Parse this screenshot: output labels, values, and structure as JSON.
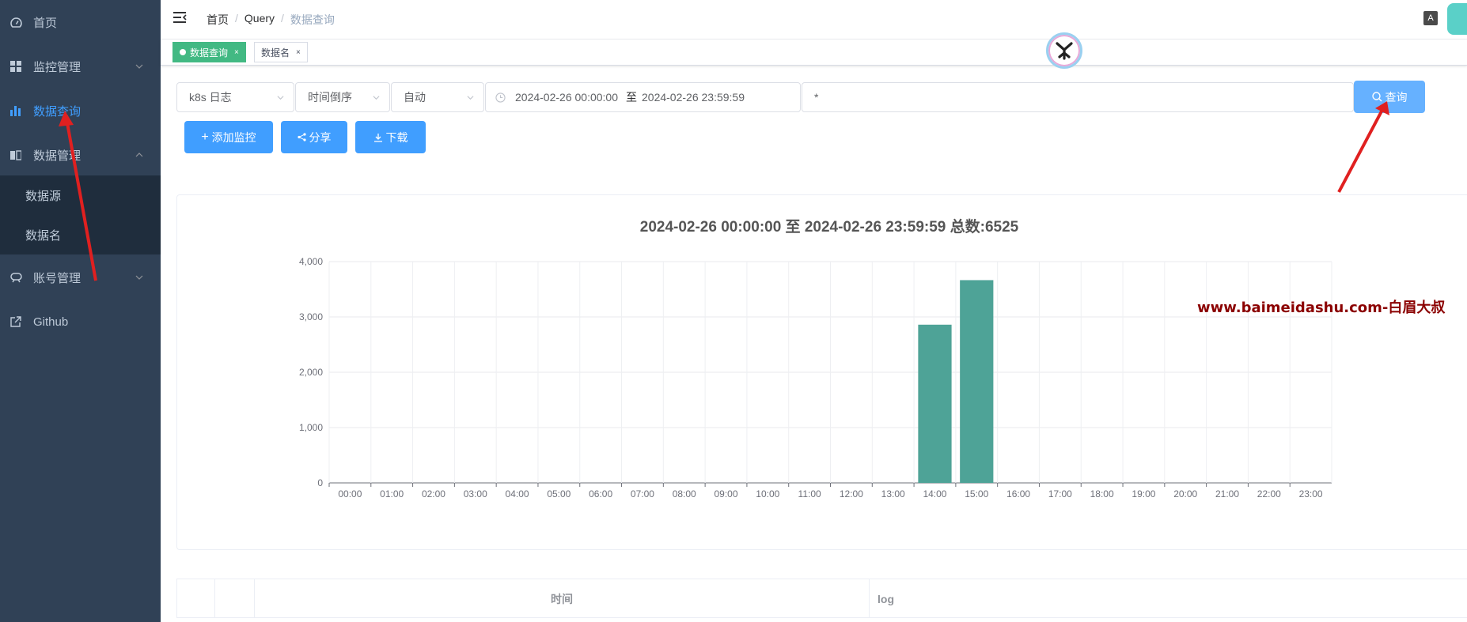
{
  "sidebar": {
    "items": [
      {
        "label": "首页",
        "icon": "dashboard-icon"
      },
      {
        "label": "监控管理",
        "icon": "grid-icon"
      },
      {
        "label": "数据查询",
        "icon": "bar-chart-icon"
      },
      {
        "label": "数据管理",
        "icon": "book-icon"
      },
      {
        "label": "账号管理",
        "icon": "user-icon"
      },
      {
        "label": "Github",
        "icon": "external-link-icon"
      }
    ],
    "sub_items": [
      "数据源",
      "数据名"
    ],
    "active_color": "#409eff",
    "bg_color": "#304156"
  },
  "navbar": {
    "breadcrumb": [
      "首页",
      "Query",
      "数据查询"
    ],
    "lang_label": "A"
  },
  "tags": [
    {
      "label": "数据查询",
      "active": true
    },
    {
      "label": "数据名",
      "active": false
    }
  ],
  "filters": {
    "source": "k8s 日志",
    "order": "时间倒序",
    "interval": "自动",
    "start": "2024-02-26 00:00:00",
    "range_sep": "至",
    "end": "2024-02-26 23:59:59",
    "query": "*",
    "query_button": "查询"
  },
  "actions": {
    "add_monitor": "添加监控",
    "share": "分享",
    "download": "下载"
  },
  "chart_data": {
    "type": "bar",
    "title": "2024-02-26 00:00:00 至 2024-02-26 23:59:59  总数:6525",
    "categories": [
      "00:00",
      "01:00",
      "02:00",
      "03:00",
      "04:00",
      "05:00",
      "06:00",
      "07:00",
      "08:00",
      "09:00",
      "10:00",
      "11:00",
      "12:00",
      "13:00",
      "14:00",
      "15:00",
      "16:00",
      "17:00",
      "18:00",
      "19:00",
      "20:00",
      "21:00",
      "22:00",
      "23:00"
    ],
    "values": [
      0,
      0,
      0,
      0,
      0,
      0,
      0,
      0,
      0,
      0,
      0,
      0,
      0,
      0,
      2860,
      3665,
      0,
      0,
      0,
      0,
      0,
      0,
      0,
      0
    ],
    "yticks": [
      "0",
      "1,000",
      "2,000",
      "3,000",
      "4,000"
    ],
    "ylim": [
      0,
      4000
    ],
    "grid": true,
    "bar_color": "#4ea397"
  },
  "watermark": "www.baimeidashu.com-白眉大叔",
  "table": {
    "columns": [
      "时间",
      "log"
    ]
  }
}
